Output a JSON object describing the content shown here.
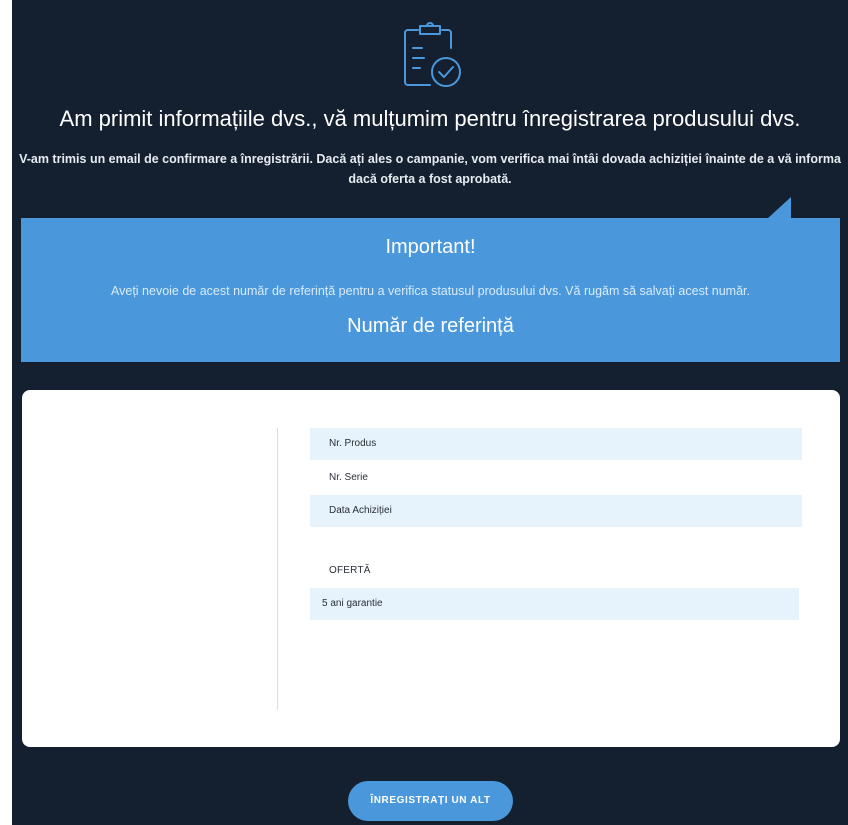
{
  "confirmation": {
    "heading": "Am primit informațiile dvs., vă mulțumim pentru înregistrarea produsului dvs.",
    "subtext": "V-am trimis un email de confirmare a înregistrării. Dacă ați ales o campanie, vom verifica mai întâi dovada achiziției înainte de a vă informa dacă oferta a fost aprobată.",
    "icon": "clipboard-check-icon"
  },
  "important": {
    "title": "Important!",
    "text": "Aveți nevoie de acest număr de referință pentru a verifica statusul produsului dvs. Vă rugăm să salvați acest număr.",
    "reference_label": "Număr de referință"
  },
  "details": {
    "product_no_label": "Nr. Produs",
    "serial_no_label": "Nr. Serie",
    "purchase_date_label": "Data Achiziției",
    "offer_label": "OFERTĂ",
    "offer_value": "5 ani garantie"
  },
  "actions": {
    "register_another_label": "ÎNREGISTRAȚI UN ALT PRODUS"
  },
  "colors": {
    "background": "#14202f",
    "accent": "#4a98db",
    "row_highlight": "#e6f2fc"
  }
}
